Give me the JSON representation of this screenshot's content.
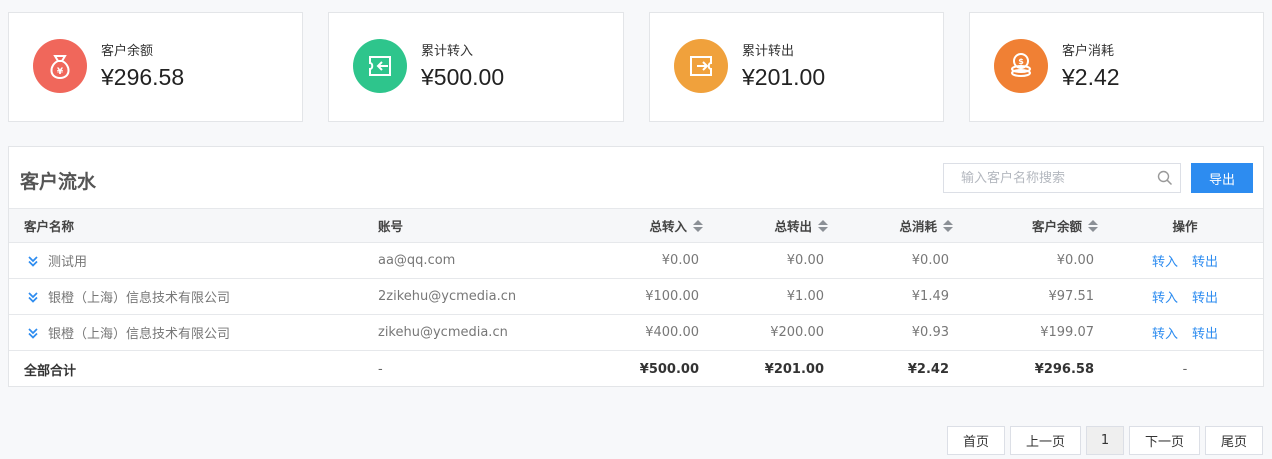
{
  "stats": [
    {
      "label": "客户余额",
      "value": "¥296.58",
      "color": "#f0675b",
      "icon": "money-bag-icon"
    },
    {
      "label": "累计转入",
      "value": "¥500.00",
      "color": "#2ec58c",
      "icon": "transfer-in-icon"
    },
    {
      "label": "累计转出",
      "value": "¥201.00",
      "color": "#f0a13c",
      "icon": "transfer-out-icon"
    },
    {
      "label": "客户消耗",
      "value": "¥2.42",
      "color": "#f08034",
      "icon": "coins-icon"
    }
  ],
  "panel": {
    "title": "客户流水",
    "search_placeholder": "输入客户名称搜索",
    "export_label": "导出"
  },
  "table": {
    "headers": {
      "name": "客户名称",
      "account": "账号",
      "in": "总转入",
      "out": "总转出",
      "consume": "总消耗",
      "balance": "客户余额",
      "action": "操作"
    },
    "rows": [
      {
        "name": "测试用",
        "account": "aa@qq.com",
        "in": "¥0.00",
        "out": "¥0.00",
        "consume": "¥0.00",
        "balance": "¥0.00",
        "act_in": "转入",
        "act_out": "转出"
      },
      {
        "name": "银橙（上海）信息技术有限公司",
        "account": "2zikehu@ycmedia.cn",
        "in": "¥100.00",
        "out": "¥1.00",
        "consume": "¥1.49",
        "balance": "¥97.51",
        "act_in": "转入",
        "act_out": "转出"
      },
      {
        "name": "银橙（上海）信息技术有限公司",
        "account": "zikehu@ycmedia.cn",
        "in": "¥400.00",
        "out": "¥200.00",
        "consume": "¥0.93",
        "balance": "¥199.07",
        "act_in": "转入",
        "act_out": "转出"
      }
    ],
    "total": {
      "name": "全部合计",
      "account": "-",
      "in": "¥500.00",
      "out": "¥201.00",
      "consume": "¥2.42",
      "balance": "¥296.58",
      "action": "-"
    }
  },
  "pagination": {
    "first": "首页",
    "prev": "上一页",
    "current": "1",
    "next": "下一页",
    "last": "尾页"
  }
}
